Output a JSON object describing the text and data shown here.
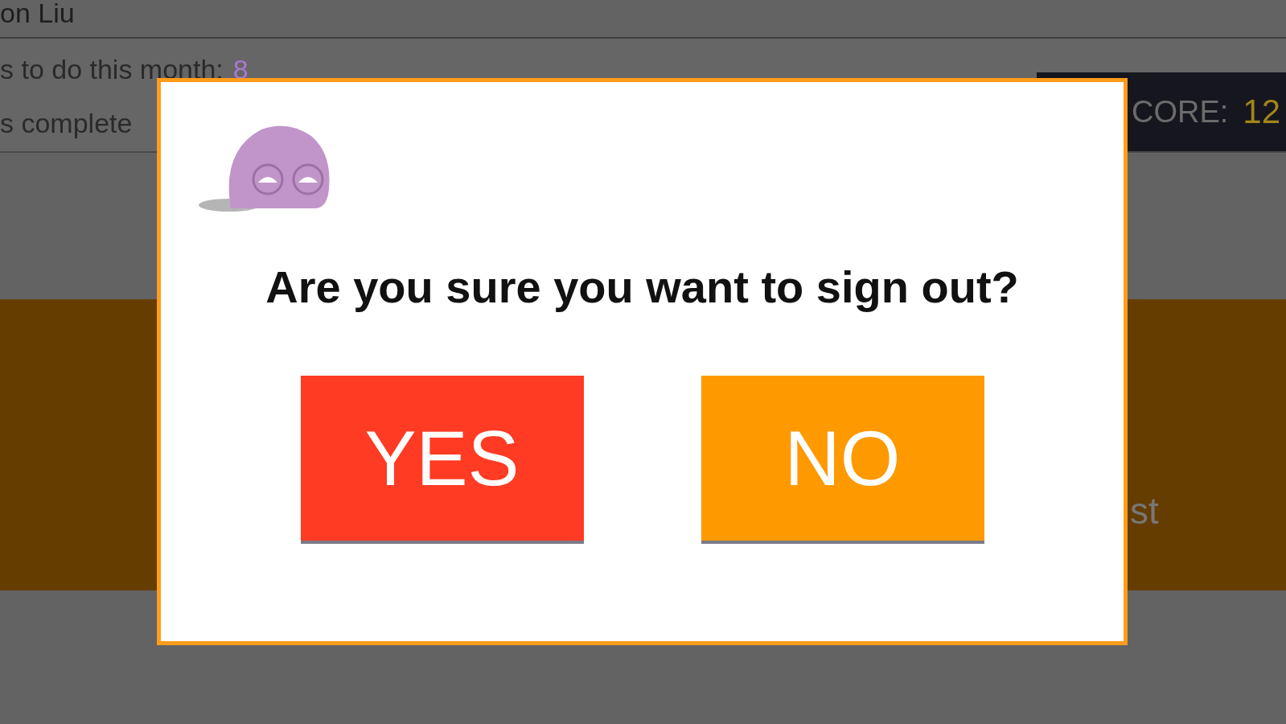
{
  "header": {
    "name": "on Liu"
  },
  "stats": [
    {
      "label": "s to do this month:",
      "value": "8"
    },
    {
      "label": "s complete"
    }
  ],
  "score": {
    "label": "CORE:",
    "value": "12"
  },
  "banner": {
    "text": "st"
  },
  "dialog": {
    "message": "Are you sure you want to sign out?",
    "buttons": [
      {
        "label": "YES",
        "kind": "confirm"
      },
      {
        "label": "NO",
        "kind": "cancel"
      }
    ]
  }
}
